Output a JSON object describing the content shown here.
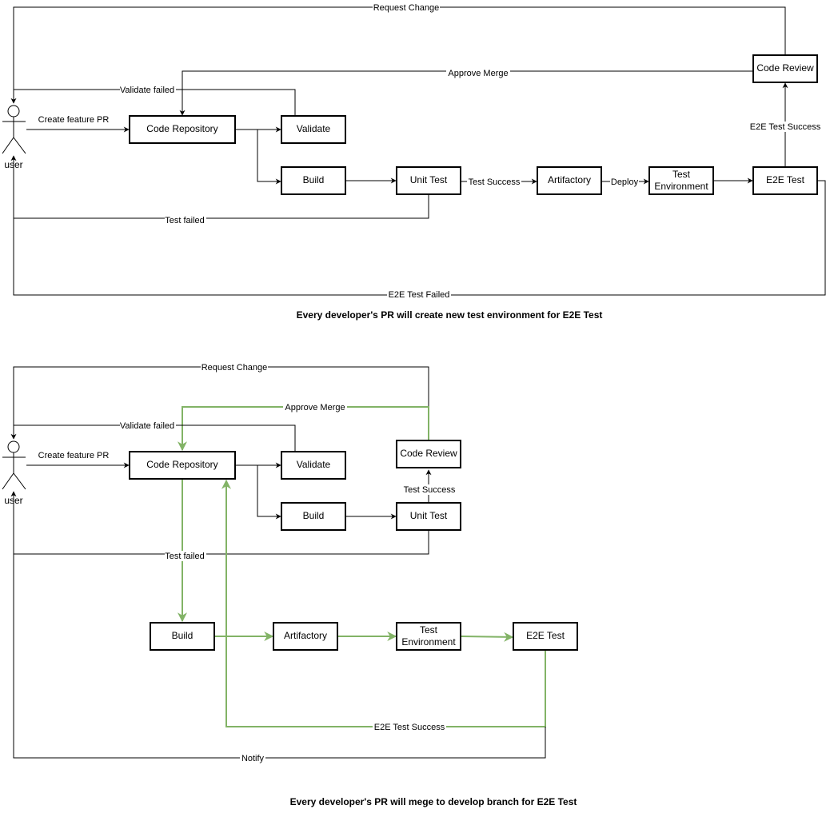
{
  "diagrams": [
    {
      "id": "top",
      "caption": "Every developer's PR will create new test environment for E2E Test",
      "actor": "user",
      "nodes": {
        "code_repository": [
          "Code Repository"
        ],
        "validate": [
          "Validate"
        ],
        "build": [
          "Build"
        ],
        "unit_test": [
          "Unit Test"
        ],
        "artifactory": [
          "Artifactory"
        ],
        "test_environment": [
          "Test",
          "Environment"
        ],
        "e2e_test": [
          "E2E Test"
        ],
        "code_review": [
          "Code Review"
        ]
      },
      "edges": {
        "create_pr": "Create feature PR",
        "validate_failed": "Validate failed",
        "test_failed": "Test failed",
        "test_success": "Test Success",
        "deploy": "Deploy",
        "e2e_success": "E2E Test Success",
        "e2e_failed": "E2E Test Failed",
        "approve_merge": "Approve Merge",
        "request_change": "Request Change"
      }
    },
    {
      "id": "bottom",
      "caption": "Every developer's PR will mege to develop branch for E2E Test",
      "actor": "user",
      "nodes": {
        "code_repository": [
          "Code Repository"
        ],
        "validate": [
          "Validate"
        ],
        "build_pr": [
          "Build"
        ],
        "unit_test": [
          "Unit Test"
        ],
        "code_review": [
          "Code Review"
        ],
        "build_dev": [
          "Build"
        ],
        "artifactory": [
          "Artifactory"
        ],
        "test_environment": [
          "Test",
          "Environment"
        ],
        "e2e_test": [
          "E2E Test"
        ]
      },
      "edges": {
        "create_pr": "Create feature PR",
        "validate_failed": "Validate failed",
        "test_failed": "Test failed",
        "test_success": "Test Success",
        "approve_merge": "Approve Merge",
        "request_change": "Request Change",
        "e2e_success": "E2E Test Success",
        "notify": "Notify"
      }
    }
  ],
  "colors": {
    "line": "#000000",
    "highlight": "#82b366",
    "node_fill": "#ffffff"
  }
}
